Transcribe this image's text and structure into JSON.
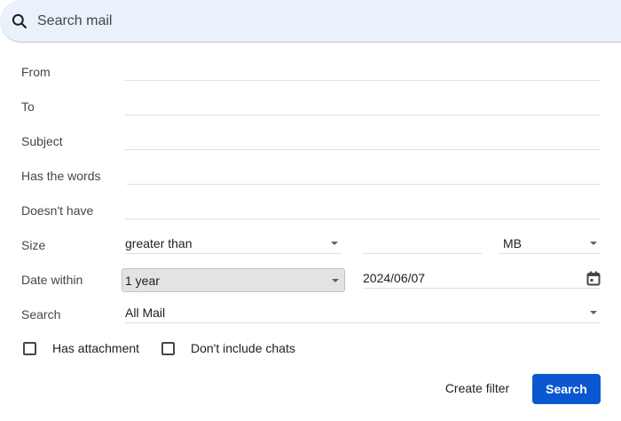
{
  "search": {
    "placeholder": "Search mail"
  },
  "labels": {
    "from": "From",
    "to": "To",
    "subject": "Subject",
    "has_words": "Has the words",
    "doesnt_have": "Doesn't have",
    "size": "Size",
    "date_within": "Date within",
    "search": "Search"
  },
  "size": {
    "operator": "greater than",
    "value": "",
    "unit": "MB"
  },
  "date": {
    "range": "1 year",
    "date": "2024/06/07"
  },
  "search_in": "All Mail",
  "checkboxes": {
    "has_attachment": "Has attachment",
    "no_chats": "Don't include chats"
  },
  "buttons": {
    "create_filter": "Create filter",
    "search": "Search"
  },
  "colors": {
    "accent": "#0b57d0",
    "searchbar": "#eaf1fb"
  }
}
